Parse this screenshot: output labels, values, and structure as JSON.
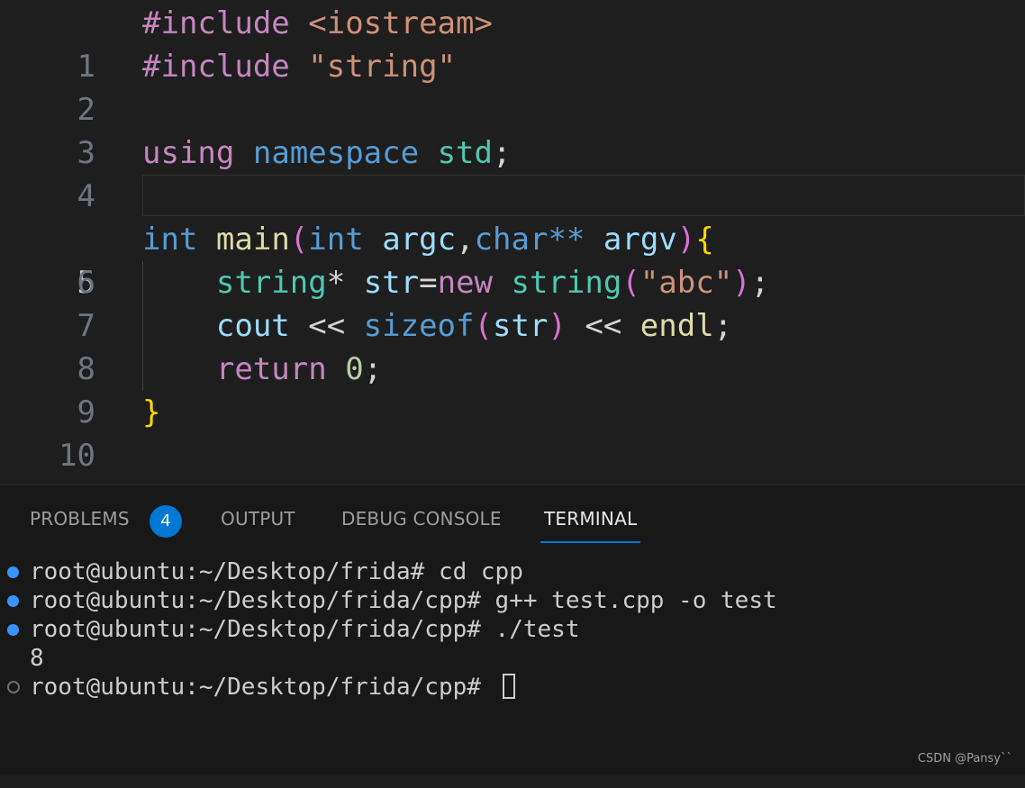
{
  "editor": {
    "line_numbers": [
      "1",
      "2",
      "3",
      "4",
      "5",
      "6",
      "7",
      "8",
      "9",
      "10"
    ],
    "current_line": "5",
    "tokens": {
      "l1_pre": "#include",
      "l1_sp": " ",
      "l1_inc": "<iostream>",
      "l2_pre": "#include",
      "l2_sp": " ",
      "l2_str": "\"string\"",
      "l4_using": "using",
      "l4_sp1": " ",
      "l4_namespace": "namespace",
      "l4_sp2": " ",
      "l4_std": "std",
      "l4_semi": ";",
      "l6_int": "int",
      "l6_sp1": " ",
      "l6_main": "main",
      "l6_lp": "(",
      "l6_int2": "int",
      "l6_sp2": " ",
      "l6_argc": "argc",
      "l6_comma": ",",
      "l6_char": "char",
      "l6_stars": "**",
      "l6_sp3": " ",
      "l6_argv": "argv",
      "l6_rp": ")",
      "l6_lb": "{",
      "l7_ind": "    ",
      "l7_string": "string",
      "l7_star": "*",
      "l7_sp": " ",
      "l7_str": "str",
      "l7_eq": "=",
      "l7_new": "new",
      "l7_sp2": " ",
      "l7_string2": "string",
      "l7_lp": "(",
      "l7_lit": "\"abc\"",
      "l7_rp": ")",
      "l7_semi": ";",
      "l8_ind": "    ",
      "l8_cout": "cout",
      "l8_op1": " << ",
      "l8_sizeof": "sizeof",
      "l8_lp": "(",
      "l8_str": "str",
      "l8_rp": ")",
      "l8_op2": " << ",
      "l8_endl": "endl",
      "l8_semi": ";",
      "l9_ind": "    ",
      "l9_return": "return",
      "l9_sp": " ",
      "l9_zero": "0",
      "l9_semi": ";",
      "l10_rb": "}"
    }
  },
  "panel": {
    "tabs": {
      "problems": "PROBLEMS",
      "problems_count": "4",
      "output": "OUTPUT",
      "debug_console": "DEBUG CONSOLE",
      "terminal": "TERMINAL"
    },
    "active_tab": "TERMINAL",
    "terminal_lines": [
      "root@ubuntu:~/Desktop/frida# cd cpp",
      "root@ubuntu:~/Desktop/frida/cpp# g++ test.cpp -o test",
      "root@ubuntu:~/Desktop/frida/cpp# ./test",
      "8",
      "root@ubuntu:~/Desktop/frida/cpp# "
    ]
  },
  "watermark": "CSDN @Pansy``",
  "colors": {
    "accent": "#0078d4",
    "editor_bg": "#1e1e1e",
    "panel_bg": "#181818"
  }
}
